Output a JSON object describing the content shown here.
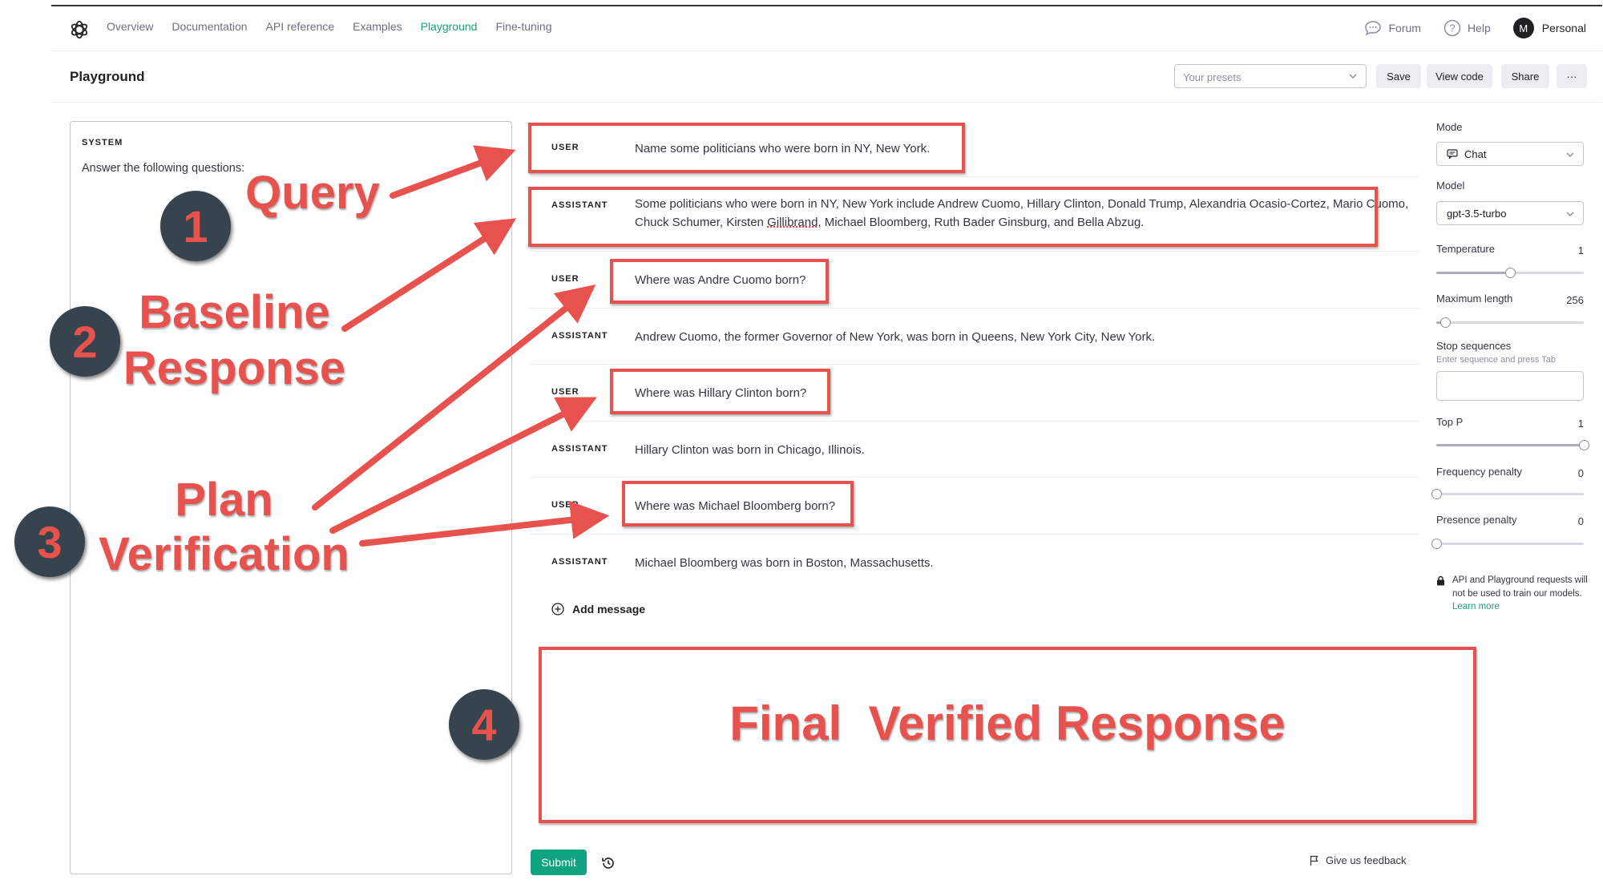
{
  "nav": {
    "items": [
      "Overview",
      "Documentation",
      "API reference",
      "Examples",
      "Playground",
      "Fine-tuning"
    ],
    "active": "Playground",
    "forum": "Forum",
    "help": "Help",
    "avatar_initial": "M",
    "account": "Personal"
  },
  "header": {
    "title": "Playground",
    "presets_placeholder": "Your presets",
    "save": "Save",
    "view_code": "View code",
    "share": "Share",
    "more": "···"
  },
  "system": {
    "label": "SYSTEM",
    "text": "Answer the following questions:"
  },
  "messages": [
    {
      "role": "USER",
      "text": "Name some politicians who were born in NY, New York."
    },
    {
      "role": "ASSISTANT",
      "text_before": "Some politicians who were born in NY, New York include Andrew Cuomo, Hillary Clinton, Donald Trump, Alexandria Ocasio-Cortez, Mario Cuomo, Chuck Schumer, Kirsten ",
      "text_flagged": "Gillibrand",
      "text_after": ", Michael Bloomberg, Ruth Bader Ginsburg, and Bella Abzug."
    },
    {
      "role": "USER",
      "text": "Where was Andre Cuomo born?"
    },
    {
      "role": "ASSISTANT",
      "text": "Andrew Cuomo, the former Governor of New York, was born in Queens, New York City, New York."
    },
    {
      "role": "USER",
      "text": "Where was Hillary Clinton born?"
    },
    {
      "role": "ASSISTANT",
      "text": "Hillary Clinton was born in Chicago, Illinois."
    },
    {
      "role": "USER",
      "text": "Where was Michael Bloomberg born?"
    },
    {
      "role": "ASSISTANT",
      "text": "Michael Bloomberg was born in Boston, Massachusetts."
    }
  ],
  "add_message": "Add message",
  "submit": "Submit",
  "feedback": "Give us feedback",
  "settings": {
    "mode_label": "Mode",
    "mode_value": "Chat",
    "model_label": "Model",
    "model_value": "gpt-3.5-turbo",
    "temperature_label": "Temperature",
    "temperature_value": "1",
    "temperature_fraction": 0.5,
    "max_length_label": "Maximum length",
    "max_length_value": "256",
    "max_length_fraction": 0.06,
    "stop_label": "Stop sequences",
    "stop_hint": "Enter sequence and press Tab",
    "top_p_label": "Top P",
    "top_p_value": "1",
    "top_p_fraction": 1.0,
    "freq_label": "Frequency penalty",
    "freq_value": "0",
    "freq_fraction": 0.0,
    "presence_label": "Presence penalty",
    "presence_value": "0",
    "presence_fraction": 0.0,
    "notice": "API and Playground requests will not be used to train our models.",
    "learn_more": "Learn more"
  },
  "annotations": {
    "step1_number": "1",
    "step1_label": "Query",
    "step2_number": "2",
    "step2_label_line1": "Baseline",
    "step2_label_line2": "Response",
    "step3_number": "3",
    "step3_label_line1": "Plan",
    "step3_label_line2": "Verification",
    "step4_number": "4",
    "step4_label": "Final  Verified Response"
  },
  "colors": {
    "accent": "#10a37f",
    "annotation_red": "#e8524e",
    "circle_fill": "#37444d"
  }
}
